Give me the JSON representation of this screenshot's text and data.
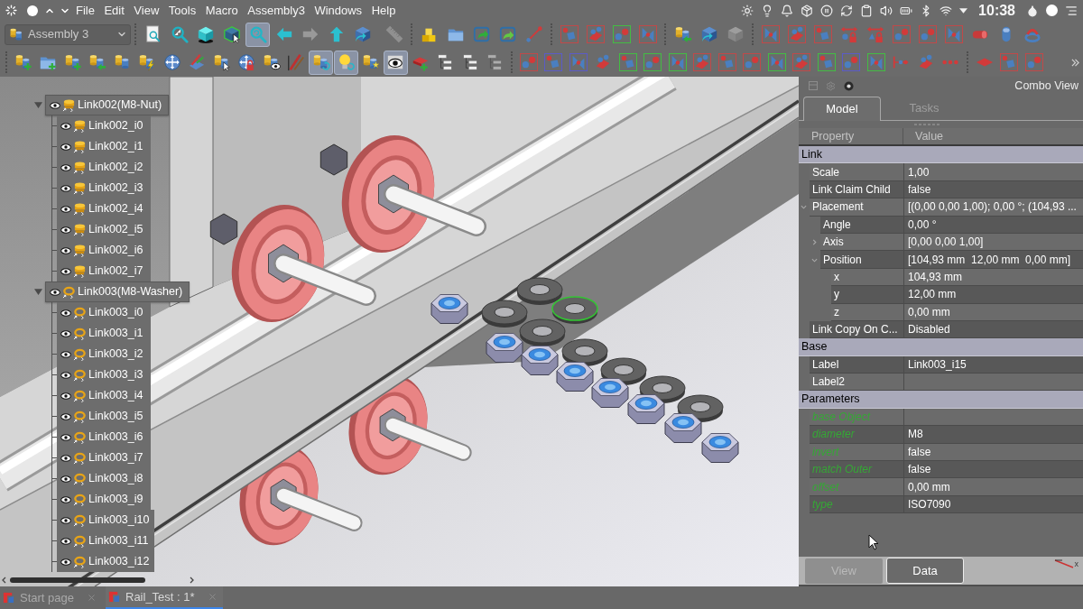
{
  "menu_bar": {
    "items": [
      "File",
      "Edit",
      "View",
      "Tools",
      "Macro",
      "Assembly3",
      "Windows",
      "Help"
    ],
    "clock": "10:38"
  },
  "toolbars": {
    "workbench": "Assembly 3",
    "row_1": [
      {
        "checked": false,
        "disabled": false
      },
      {
        "checked": false,
        "disabled": false
      },
      {
        "checked": false,
        "disabled": false
      },
      {
        "checked": false,
        "disabled": false
      },
      {
        "checked": true,
        "disabled": false
      },
      {
        "checked": false,
        "disabled": false
      },
      {
        "checked": false,
        "disabled": true
      },
      {
        "checked": false,
        "disabled": false
      },
      {
        "checked": false,
        "disabled": false
      },
      {
        "checked": false,
        "disabled": true
      },
      {
        "checked": false,
        "disabled": false
      },
      {
        "checked": false,
        "disabled": false
      },
      {
        "checked": false,
        "disabled": false
      },
      {
        "checked": false,
        "disabled": false
      },
      {
        "checked": false,
        "disabled": false
      },
      {
        "checked": false,
        "disabled": false
      },
      {
        "checked": false,
        "disabled": false
      },
      {
        "checked": false,
        "disabled": false
      },
      {
        "checked": false,
        "disabled": false
      },
      {
        "checked": false,
        "disabled": false
      },
      {
        "checked": false,
        "disabled": false
      },
      {
        "checked": false,
        "disabled": true
      },
      {
        "checked": false,
        "disabled": false
      },
      {
        "checked": false,
        "disabled": false
      },
      {
        "checked": false,
        "disabled": false
      },
      {
        "checked": false,
        "disabled": false
      },
      {
        "checked": false,
        "disabled": false
      },
      {
        "checked": false,
        "disabled": false
      },
      {
        "checked": false,
        "disabled": false
      },
      {
        "checked": false,
        "disabled": false
      },
      {
        "checked": false,
        "disabled": false
      },
      {
        "checked": false,
        "disabled": false
      },
      {
        "checked": false,
        "disabled": false
      }
    ],
    "row_2": [
      {
        "checked": false,
        "disabled": false
      },
      {
        "checked": false,
        "disabled": false
      },
      {
        "checked": false,
        "disabled": false
      },
      {
        "checked": false,
        "disabled": false
      },
      {
        "checked": false,
        "disabled": false
      },
      {
        "checked": false,
        "disabled": false
      },
      {
        "checked": false,
        "disabled": false
      },
      {
        "checked": false,
        "disabled": false
      },
      {
        "checked": false,
        "disabled": false
      },
      {
        "checked": false,
        "disabled": false
      },
      {
        "checked": false,
        "disabled": false
      },
      {
        "checked": false,
        "disabled": false
      },
      {
        "checked": true,
        "disabled": false
      },
      {
        "checked": true,
        "disabled": false
      },
      {
        "checked": false,
        "disabled": false
      },
      {
        "checked": true,
        "disabled": false
      },
      {
        "checked": false,
        "disabled": false
      },
      {
        "checked": false,
        "disabled": false
      },
      {
        "checked": false,
        "disabled": false
      },
      {
        "checked": false,
        "disabled": true
      },
      {
        "checked": false,
        "disabled": false
      },
      {
        "checked": false,
        "disabled": false
      },
      {
        "checked": false,
        "disabled": false
      },
      {
        "checked": false,
        "disabled": false
      },
      {
        "checked": false,
        "disabled": false
      },
      {
        "checked": false,
        "disabled": false
      },
      {
        "checked": false,
        "disabled": false
      },
      {
        "checked": false,
        "disabled": false
      },
      {
        "checked": false,
        "disabled": false
      },
      {
        "checked": false,
        "disabled": false
      },
      {
        "checked": false,
        "disabled": false
      },
      {
        "checked": false,
        "disabled": false
      },
      {
        "checked": false,
        "disabled": false
      },
      {
        "checked": false,
        "disabled": false
      },
      {
        "checked": false,
        "disabled": false
      },
      {
        "checked": false,
        "disabled": false
      },
      {
        "checked": false,
        "disabled": false
      },
      {
        "checked": false,
        "disabled": false
      },
      {
        "checked": false,
        "disabled": false
      },
      {
        "checked": false,
        "disabled": false
      },
      {
        "checked": false,
        "disabled": false
      }
    ]
  },
  "tree": [
    {
      "label": "Link002(M8-Nut)",
      "kind": "nut",
      "expanded": true,
      "children": [
        {
          "label": "Link002_i0"
        },
        {
          "label": "Link002_i1"
        },
        {
          "label": "Link002_i2"
        },
        {
          "label": "Link002_i3"
        },
        {
          "label": "Link002_i4"
        },
        {
          "label": "Link002_i5"
        },
        {
          "label": "Link002_i6"
        },
        {
          "label": "Link002_i7"
        }
      ]
    },
    {
      "label": "Link003(M8-Washer)",
      "kind": "washer",
      "expanded": true,
      "children": [
        {
          "label": "Link003_i0"
        },
        {
          "label": "Link003_i1"
        },
        {
          "label": "Link003_i2"
        },
        {
          "label": "Link003_i3"
        },
        {
          "label": "Link003_i4"
        },
        {
          "label": "Link003_i5"
        },
        {
          "label": "Link003_i6"
        },
        {
          "label": "Link003_i7"
        },
        {
          "label": "Link003_i8"
        },
        {
          "label": "Link003_i9"
        },
        {
          "label": "Link003_i10"
        },
        {
          "label": "Link003_i11"
        },
        {
          "label": "Link003_i12"
        }
      ]
    }
  ],
  "combo_view": {
    "title": "Combo View",
    "tabs": [
      {
        "label": "Model",
        "selected": true
      },
      {
        "label": "Tasks",
        "selected": false
      }
    ],
    "columns": [
      "Property",
      "Value"
    ],
    "groups": [
      {
        "name": "Link",
        "kind": "plain",
        "rows": [
          {
            "name": "Scale",
            "value": "1,00"
          },
          {
            "name": "Link Claim Child",
            "value": "false"
          },
          {
            "name": "Placement",
            "value": "[(0,00 0,00 1,00); 0,00 °; (104,93 ...",
            "expanded": true,
            "children": [
              {
                "name": "Angle",
                "value": "0,00 °"
              },
              {
                "name": "Axis",
                "value": "[0,00 0,00 1,00]",
                "expanded": false
              },
              {
                "name": "Position",
                "value": "[104,93 mm  12,00 mm  0,00 mm]",
                "expanded": true,
                "children": [
                  {
                    "name": "x",
                    "value": "104,93 mm"
                  },
                  {
                    "name": "y",
                    "value": "12,00 mm"
                  },
                  {
                    "name": "z",
                    "value": "0,00 mm"
                  }
                ]
              }
            ]
          },
          {
            "name": "Link Copy On C...",
            "value": "Disabled"
          }
        ]
      },
      {
        "name": "Base",
        "kind": "plain",
        "rows": [
          {
            "name": "Label",
            "value": "Link003_i15"
          },
          {
            "name": "Label2"
          }
        ]
      },
      {
        "name": "Parameters",
        "kind": "custom",
        "rows": [
          {
            "name": "base Object"
          },
          {
            "name": "diameter",
            "value": "M8"
          },
          {
            "name": "invert",
            "value": "false"
          },
          {
            "name": "match Outer",
            "value": "false"
          },
          {
            "name": "offset",
            "value": "0,00 mm"
          },
          {
            "name": "type",
            "value": "ISO7090"
          }
        ]
      }
    ],
    "bottom_tabs": [
      {
        "label": "View",
        "selected": false
      },
      {
        "label": "Data",
        "selected": true
      }
    ],
    "axis_label": "x"
  },
  "document_tabs": [
    {
      "label": "Start page",
      "selected": false
    },
    {
      "label": "Rail_Test : 1*",
      "selected": true
    }
  ]
}
